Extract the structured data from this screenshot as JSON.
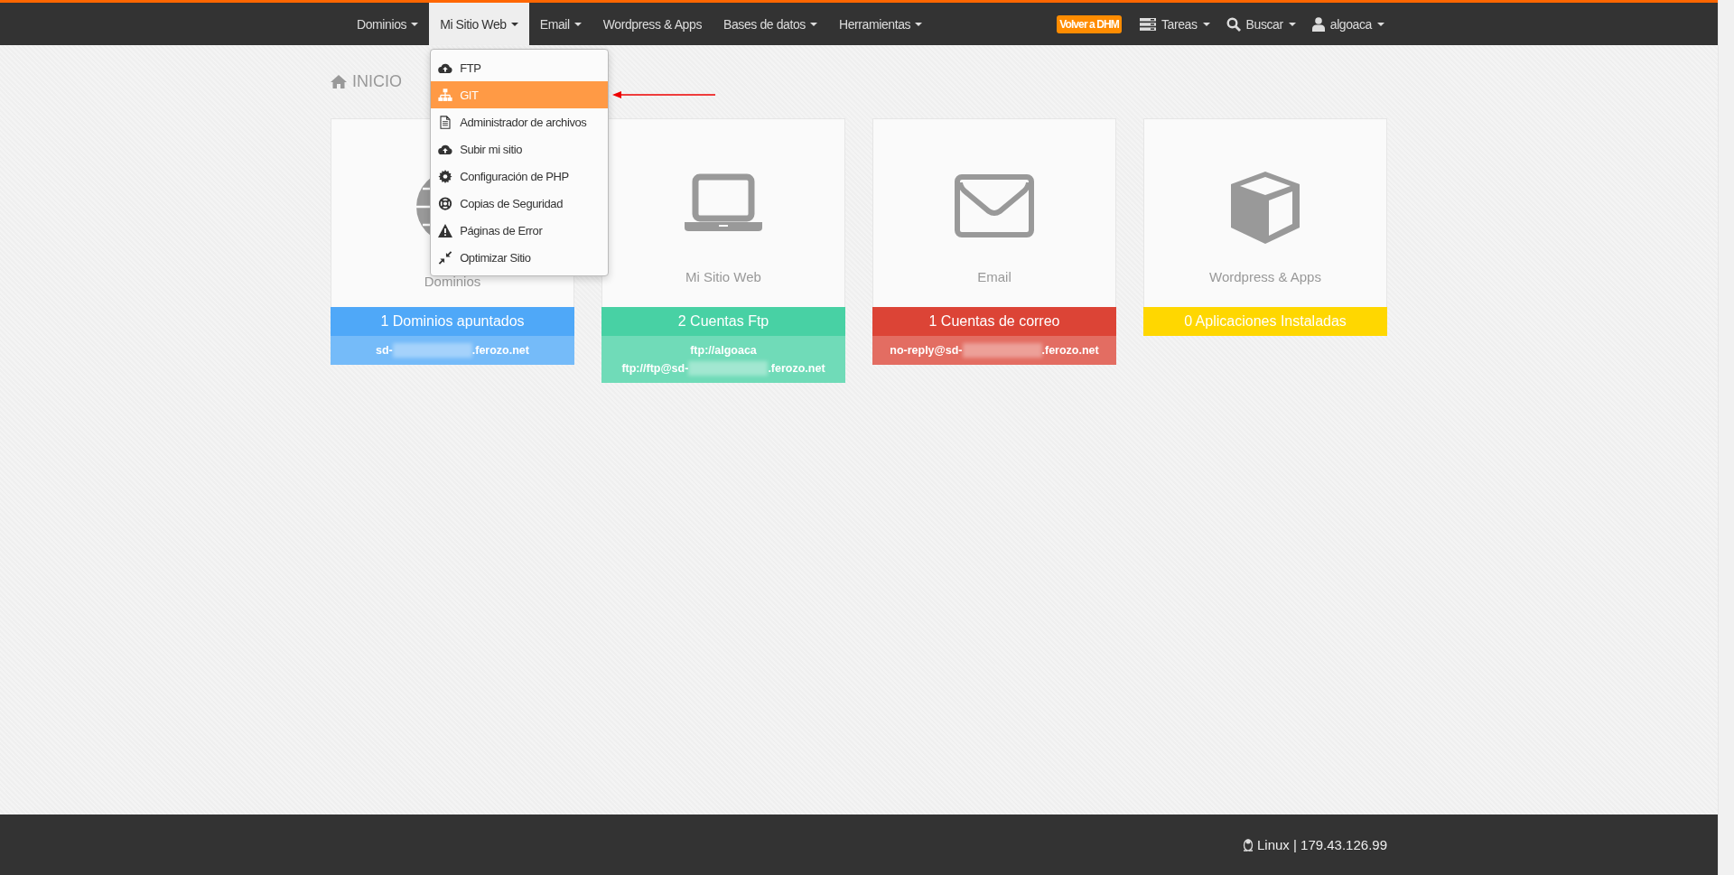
{
  "nav": {
    "items": [
      {
        "label": "Dominios",
        "selected": false,
        "caret": true
      },
      {
        "label": "Mi Sitio Web",
        "selected": true,
        "caret": true,
        "open": true
      },
      {
        "label": "Email",
        "selected": false,
        "caret": true
      },
      {
        "label": "Wordpress & Apps",
        "selected": false,
        "caret": false
      },
      {
        "label": "Bases de datos",
        "selected": false,
        "caret": true
      },
      {
        "label": "Herramientas",
        "selected": false,
        "caret": true
      }
    ],
    "back_button": "Volver a DHM",
    "right_items": [
      {
        "kind": "tasks",
        "label": "Tareas"
      },
      {
        "kind": "search",
        "label": "Buscar"
      },
      {
        "kind": "user",
        "label": "algoaca"
      }
    ]
  },
  "dropdown": {
    "items": [
      {
        "kind": "cloud",
        "label": "FTP",
        "selected": false
      },
      {
        "kind": "sitemap",
        "label": "GIT",
        "selected": true
      },
      {
        "kind": "file",
        "label": "Administrador de archivos",
        "selected": false
      },
      {
        "kind": "cloud",
        "label": "Subir mi sitio",
        "selected": false
      },
      {
        "kind": "gear",
        "label": "Configuración de PHP",
        "selected": false
      },
      {
        "kind": "lifebuoy",
        "label": "Copias de Seguridad",
        "selected": false
      },
      {
        "kind": "warning",
        "label": "Páginas de Error",
        "selected": false
      },
      {
        "kind": "compress",
        "label": "Optimizar Sitio",
        "selected": false
      }
    ]
  },
  "heading": "INICIO",
  "cards": [
    {
      "kind": "globe",
      "title": "Dominios",
      "stat": "1 Dominios apuntados",
      "color": "#4fa8f8",
      "details": [
        {
          "parts": [
            "sd-",
            ".ferozo.net"
          ]
        }
      ]
    },
    {
      "kind": "laptop",
      "title": "Mi Sitio Web",
      "stat": "2 Cuentas Ftp",
      "color": "#48d1a4",
      "details": [
        {
          "parts": [
            "ftp://algoaca"
          ]
        },
        {
          "parts": [
            "ftp://ftp@sd-",
            ".ferozo.net"
          ]
        }
      ]
    },
    {
      "kind": "envelope",
      "title": "Email",
      "stat": "1 Cuentas de correo",
      "color": "#dc4436",
      "details": [
        {
          "parts": [
            "no-reply@sd-",
            ".ferozo.net"
          ]
        }
      ]
    },
    {
      "kind": "cube",
      "title": "Wordpress & Apps",
      "stat": "0 Aplicaciones Instaladas",
      "color": "#ffd700"
    }
  ],
  "footer": {
    "server": "Linux | 179.43.126.99"
  }
}
